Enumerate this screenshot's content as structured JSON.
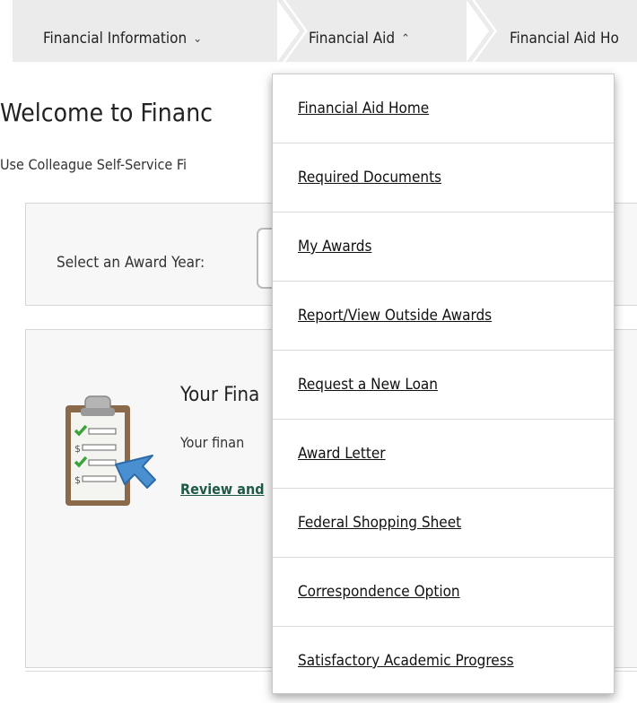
{
  "breadcrumb": {
    "items": [
      {
        "label": "Financial Information",
        "chevron": "chevron-down"
      },
      {
        "label": "Financial Aid",
        "chevron": "chevron-up"
      },
      {
        "label": "Financial Aid Ho"
      }
    ]
  },
  "page": {
    "title": "Welcome to Financ",
    "subtitle": "Use Colleague Self-Service Fi"
  },
  "award_year": {
    "label": "Select an Award Year:"
  },
  "financial_box": {
    "title": "Your Fina",
    "text": "Your finan",
    "link": "Review and",
    "icon": "clipboard-checklist-icon"
  },
  "menu": {
    "items": [
      {
        "label": "Financial Aid Home"
      },
      {
        "label": "Required Documents"
      },
      {
        "label": "My Awards"
      },
      {
        "label": "Report/View Outside Awards"
      },
      {
        "label": "Request a New Loan"
      },
      {
        "label": "Award Letter"
      },
      {
        "label": "Federal Shopping Sheet"
      },
      {
        "label": "Correspondence Option"
      },
      {
        "label": "Satisfactory Academic Progress"
      }
    ]
  },
  "colors": {
    "crumb_bg": "#ebebeb",
    "link_green": "#1e5a46",
    "panel_bg": "#f7f7f7"
  }
}
